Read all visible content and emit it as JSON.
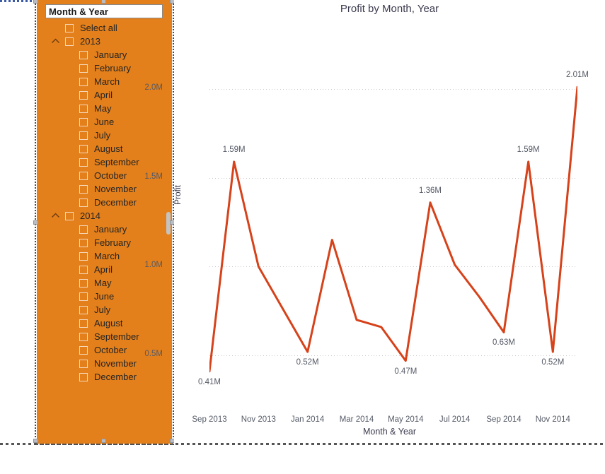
{
  "page": {
    "background": "#ffffff",
    "slicer_fill": "#E4801B",
    "line_color": "#D6421A"
  },
  "slicer": {
    "header": "Month & Year",
    "scroll_thumb": true,
    "items": [
      {
        "label": "Select all",
        "level": "root",
        "checked": false,
        "expander": null
      },
      {
        "label": "2013",
        "level": "year",
        "checked": false,
        "expander": "chevron-up"
      },
      {
        "label": "January",
        "level": "month",
        "checked": false,
        "expander": null
      },
      {
        "label": "February",
        "level": "month",
        "checked": false,
        "expander": null
      },
      {
        "label": "March",
        "level": "month",
        "checked": false,
        "expander": null
      },
      {
        "label": "April",
        "level": "month",
        "checked": false,
        "expander": null
      },
      {
        "label": "May",
        "level": "month",
        "checked": false,
        "expander": null
      },
      {
        "label": "June",
        "level": "month",
        "checked": false,
        "expander": null
      },
      {
        "label": "July",
        "level": "month",
        "checked": false,
        "expander": null
      },
      {
        "label": "August",
        "level": "month",
        "checked": false,
        "expander": null
      },
      {
        "label": "September",
        "level": "month",
        "checked": false,
        "expander": null
      },
      {
        "label": "October",
        "level": "month",
        "checked": false,
        "expander": null
      },
      {
        "label": "November",
        "level": "month",
        "checked": false,
        "expander": null
      },
      {
        "label": "December",
        "level": "month",
        "checked": false,
        "expander": null
      },
      {
        "label": "2014",
        "level": "year",
        "checked": false,
        "expander": "chevron-up"
      },
      {
        "label": "January",
        "level": "month",
        "checked": false,
        "expander": null
      },
      {
        "label": "February",
        "level": "month",
        "checked": false,
        "expander": null
      },
      {
        "label": "March",
        "level": "month",
        "checked": false,
        "expander": null
      },
      {
        "label": "April",
        "level": "month",
        "checked": false,
        "expander": null
      },
      {
        "label": "May",
        "level": "month",
        "checked": false,
        "expander": null
      },
      {
        "label": "June",
        "level": "month",
        "checked": false,
        "expander": null
      },
      {
        "label": "July",
        "level": "month",
        "checked": false,
        "expander": null
      },
      {
        "label": "August",
        "level": "month",
        "checked": false,
        "expander": null
      },
      {
        "label": "September",
        "level": "month",
        "checked": false,
        "expander": null
      },
      {
        "label": "October",
        "level": "month",
        "checked": false,
        "expander": null
      },
      {
        "label": "November",
        "level": "month",
        "checked": false,
        "expander": null
      },
      {
        "label": "December",
        "level": "month",
        "checked": false,
        "expander": null
      }
    ]
  },
  "chart_data": {
    "type": "line",
    "title": "Profit by Month, Year",
    "xlabel": "Month & Year",
    "ylabel": "Profit",
    "grid": true,
    "legend": false,
    "line_color": "#D6421A",
    "ylim": [
      250000,
      2150000
    ],
    "yticks": [
      500000,
      1000000,
      1500000,
      2000000
    ],
    "ytick_labels": [
      "0.5M",
      "1.0M",
      "1.5M",
      "2.0M"
    ],
    "xtick_labels": [
      "Sep 2013",
      "Nov 2013",
      "Jan 2014",
      "Mar 2014",
      "May 2014",
      "Jul 2014",
      "Sep 2014",
      "Nov 2014"
    ],
    "categories": [
      "Sep 2013",
      "Oct 2013",
      "Nov 2013",
      "Dec 2013",
      "Jan 2014",
      "Feb 2014",
      "Mar 2014",
      "Apr 2014",
      "May 2014",
      "Jun 2014",
      "Jul 2014",
      "Aug 2014",
      "Sep 2014",
      "Oct 2014",
      "Nov 2014",
      "Dec 2014"
    ],
    "values": [
      410000,
      1590000,
      1000000,
      760000,
      520000,
      1150000,
      700000,
      660000,
      470000,
      1360000,
      1010000,
      830000,
      630000,
      1590000,
      520000,
      2010000
    ],
    "point_labels": [
      {
        "index": 0,
        "text": "0.41M",
        "position": "below"
      },
      {
        "index": 1,
        "text": "1.59M",
        "position": "above"
      },
      {
        "index": 4,
        "text": "0.52M",
        "position": "below"
      },
      {
        "index": 8,
        "text": "0.47M",
        "position": "below"
      },
      {
        "index": 9,
        "text": "1.36M",
        "position": "above"
      },
      {
        "index": 12,
        "text": "0.63M",
        "position": "below"
      },
      {
        "index": 13,
        "text": "1.59M",
        "position": "above"
      },
      {
        "index": 14,
        "text": "0.52M",
        "position": "below"
      },
      {
        "index": 15,
        "text": "2.01M",
        "position": "above"
      }
    ]
  }
}
